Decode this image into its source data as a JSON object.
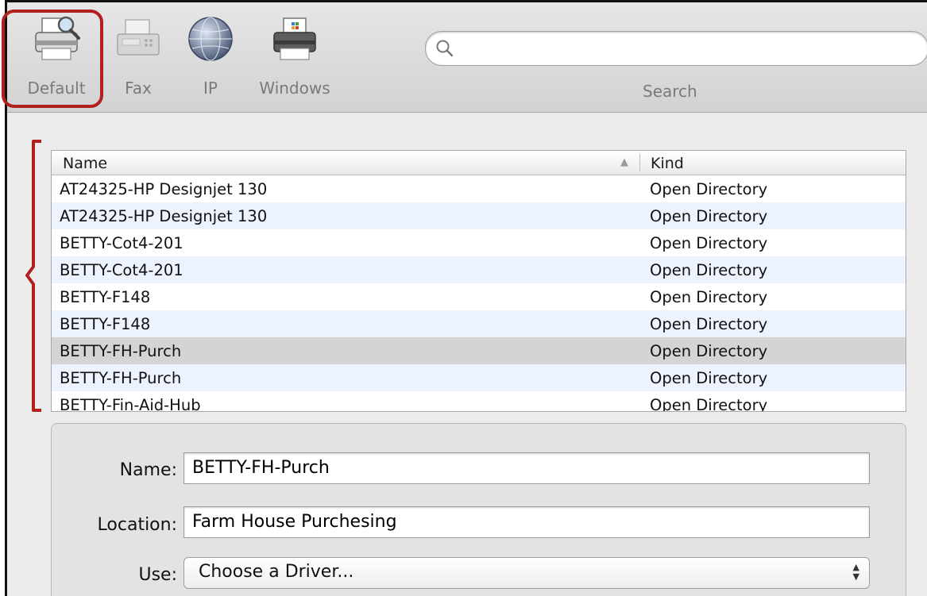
{
  "toolbar": {
    "buttons": [
      {
        "label": "Default",
        "icon": "printer-magnifier-icon"
      },
      {
        "label": "Fax",
        "icon": "fax-icon"
      },
      {
        "label": "IP",
        "icon": "globe-icon"
      },
      {
        "label": "Windows",
        "icon": "printer-windows-icon"
      }
    ],
    "search_label": "Search",
    "search_value": ""
  },
  "table": {
    "columns": {
      "name": "Name",
      "kind": "Kind"
    },
    "rows": [
      {
        "name": "AT24325-HP Designjet 130",
        "kind": "Open Directory"
      },
      {
        "name": "AT24325-HP Designjet 130",
        "kind": "Open Directory"
      },
      {
        "name": "BETTY-Cot4-201",
        "kind": "Open Directory"
      },
      {
        "name": "BETTY-Cot4-201",
        "kind": "Open Directory"
      },
      {
        "name": "BETTY-F148",
        "kind": "Open Directory"
      },
      {
        "name": "BETTY-F148",
        "kind": "Open Directory"
      },
      {
        "name": "BETTY-FH-Purch",
        "kind": "Open Directory"
      },
      {
        "name": "BETTY-FH-Purch",
        "kind": "Open Directory"
      },
      {
        "name": "BETTY-Fin-Aid-Hub",
        "kind": "Open Directory"
      }
    ]
  },
  "form": {
    "name_label": "Name:",
    "name_value": "BETTY-FH-Purch",
    "location_label": "Location:",
    "location_value": "Farm House Purchesing",
    "use_label": "Use:",
    "use_value": "Choose a Driver..."
  },
  "colors": {
    "highlight": "#b11f1f",
    "selected_row": "#d4d4d4",
    "alt_row": "#edf3fe"
  }
}
